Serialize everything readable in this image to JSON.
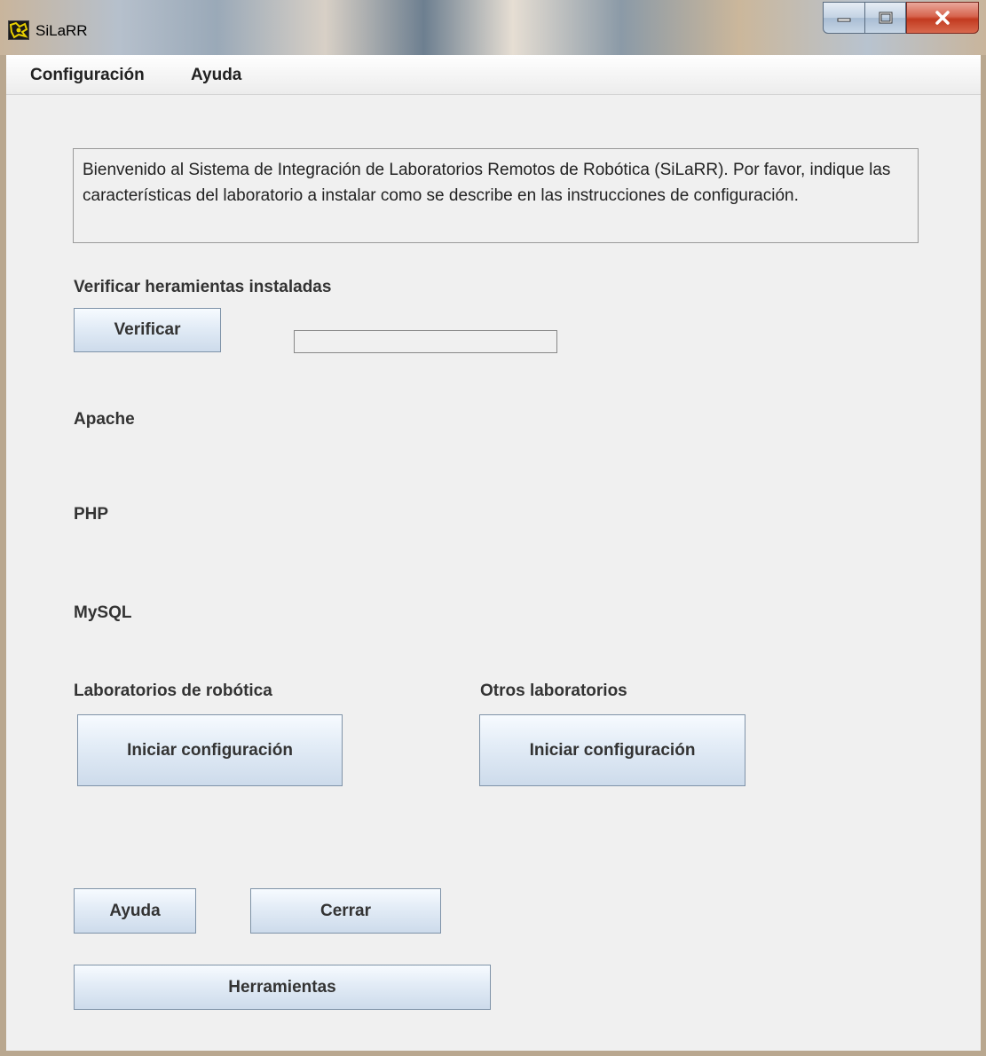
{
  "window": {
    "title": "SiLaRR"
  },
  "menu": {
    "items": [
      "Configuración",
      "Ayuda"
    ]
  },
  "welcome_text": "Bienvenido al Sistema de Integración de Laboratorios Remotos de Robótica (SiLaRR). Por favor, indique las características del laboratorio a instalar como se describe en las instrucciones de configuración.",
  "verify": {
    "heading": "Verificar heramientas instaladas",
    "button": "Verificar",
    "progress": 0
  },
  "tools": {
    "apache": "Apache",
    "php": "PHP",
    "mysql": "MySQL"
  },
  "robotics": {
    "heading": "Laboratorios de robótica",
    "button": "Iniciar configuración"
  },
  "others": {
    "heading": "Otros laboratorios",
    "button": "Iniciar configuración"
  },
  "bottom": {
    "help": "Ayuda",
    "close": "Cerrar",
    "tools": "Herramientas"
  },
  "icons": {
    "app": "silarr-app-icon",
    "minimize": "minimize-icon",
    "maximize": "maximize-icon",
    "close": "close-icon"
  },
  "colors": {
    "close_button": "#c23a20",
    "button_gradient_bottom": "#cddbeb",
    "window_bg": "#f0f0f0"
  }
}
